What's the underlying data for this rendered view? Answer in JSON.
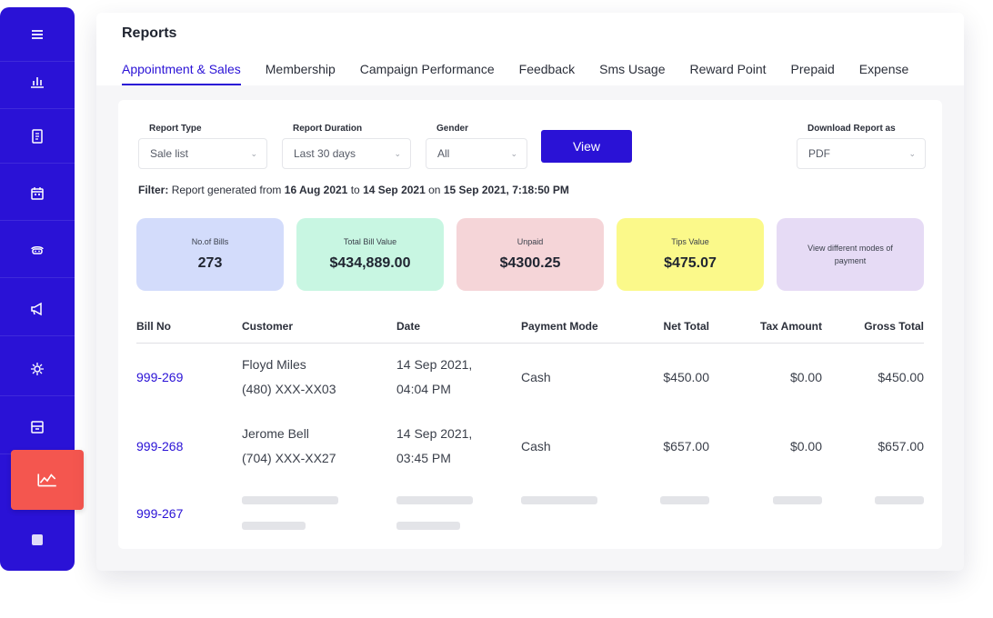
{
  "sidebar": {
    "items": [
      {
        "icon": "menu-icon"
      },
      {
        "icon": "bar-chart-icon"
      },
      {
        "icon": "document-icon"
      },
      {
        "icon": "calendar-icon"
      },
      {
        "icon": "staff-icon"
      },
      {
        "icon": "megaphone-icon"
      },
      {
        "icon": "settings-icon"
      },
      {
        "icon": "inventory-icon"
      },
      {
        "icon": "reports-icon",
        "active": true
      },
      {
        "icon": "grid-icon"
      }
    ]
  },
  "header": {
    "title": "Reports",
    "tabs": [
      {
        "label": "Appointment & Sales",
        "active": true
      },
      {
        "label": "Membership"
      },
      {
        "label": "Campaign Performance"
      },
      {
        "label": "Feedback"
      },
      {
        "label": "Sms Usage"
      },
      {
        "label": "Reward Point"
      },
      {
        "label": "Prepaid"
      },
      {
        "label": "Expense"
      }
    ]
  },
  "filters": {
    "report_type": {
      "label": "Report Type",
      "value": "Sale list"
    },
    "report_duration": {
      "label": "Report Duration",
      "value": "Last 30 days"
    },
    "gender": {
      "label": "Gender",
      "value": "All"
    },
    "view_label": "View",
    "download": {
      "label": "Download Report as",
      "value": "PDF"
    }
  },
  "filter_summary": {
    "prefix": "Filter:",
    "text1": "Report generated from",
    "from": "16 Aug 2021",
    "to_word": "to",
    "to": "14 Sep 2021",
    "on_word": "on",
    "generated": "15 Sep 2021, 7:18:50 PM"
  },
  "stats": [
    {
      "label": "No.of Bills",
      "value": "273",
      "color": "#d3dcfb"
    },
    {
      "label": "Total Bill Value",
      "value": "$434,889.00",
      "color": "#c8f6e2"
    },
    {
      "label": "Unpaid",
      "value": "$4300.25",
      "color": "#f5d5d8"
    },
    {
      "label": "Tips Value",
      "value": "$475.07",
      "color": "#fbf98a"
    },
    {
      "label": "View different modes of payment",
      "color": "#e6dbf5"
    }
  ],
  "table": {
    "columns": [
      "Bill No",
      "Customer",
      "Date",
      "Payment Mode",
      "Net Total",
      "Tax Amount",
      "Gross Total"
    ],
    "rows": [
      {
        "bill_no": "999-269",
        "customer_name": "Floyd Miles",
        "customer_phone": "(480) XXX-XX03",
        "date": "14 Sep 2021,",
        "time": "04:04 PM",
        "payment_mode": "Cash",
        "net_total": "$450.00",
        "tax_amount": "$0.00",
        "gross_total": "$450.00"
      },
      {
        "bill_no": "999-268",
        "customer_name": "Jerome Bell",
        "customer_phone": "(704) XXX-XX27",
        "date": "14 Sep 2021,",
        "time": "03:45 PM",
        "payment_mode": "Cash",
        "net_total": "$657.00",
        "tax_amount": "$0.00",
        "gross_total": "$657.00"
      },
      {
        "bill_no": "999-267"
      }
    ]
  },
  "colors": {
    "accent": "#2a12d6",
    "active_sidebar": "#f4564f"
  }
}
